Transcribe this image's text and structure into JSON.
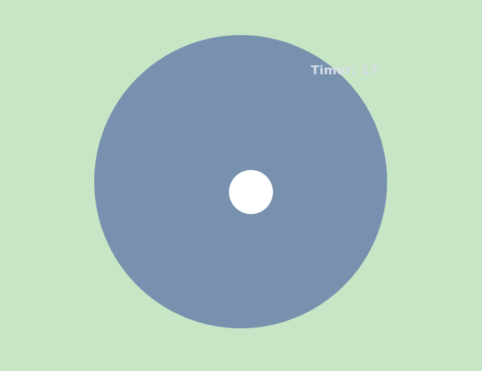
{
  "game": {
    "timer_text": "Timer: 17"
  },
  "colors": {
    "background": "#c8e6c6",
    "arena": "#7891af",
    "player": "#ffffff",
    "timer_text": "#d6dee8"
  }
}
